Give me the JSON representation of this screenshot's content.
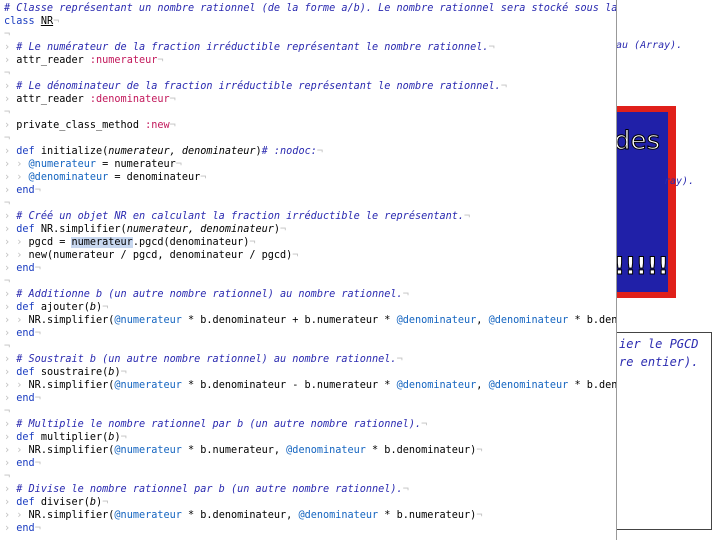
{
  "background": {
    "top_fragments": [
      "au (Array).",
      "ray)."
    ],
    "banner_text": "des",
    "banner_exclaim": "!!!!!",
    "mid_fragments": [
      "ier le PGCD",
      "re entier)."
    ],
    "colors": {
      "red": "#e0201a",
      "blue": "#2020a8"
    }
  },
  "editor": {
    "line_1_comment": "# Classe représentant un nombre rationnel (de la forme a/b). Le nombre rationnel sera stocké sous la forme d'un",
    "line_2_class_kw": "class",
    "line_2_class_name": "NR",
    "comment_num": "# Le numérateur de la fraction irréductible représentant le nombre rationnel.",
    "attr_reader": "attr_reader",
    "sym_num": ":numerateur",
    "comment_den": "# Le dénominateur de la fraction irréductible représentant le nombre rationnel.",
    "sym_den": ":denominateur",
    "private": "private_class_method",
    "sym_new": ":new",
    "def": "def",
    "end": "end",
    "init_name": "initialize(",
    "init_params": "numerateur, denominateur",
    "nodoc": "# :nodoc:",
    "iv_num": "@numerateur",
    "iv_den": "@denominateur",
    "assign_num": " = numerateur",
    "assign_den": " = denominateur",
    "comment_simp": "# Créé un objet NR en calculant la fraction irréductible le représentant.",
    "simp_name": "NR.simplifier(",
    "simp_params": "numerateur, denominateur",
    "pgcd_pre": "pgcd = ",
    "pgcd_hl": "numerateur",
    "pgcd_post": ".pgcd(denominateur)",
    "new_call": "new(numerateur / pgcd, denominateur / pgcd)",
    "comment_add": "# Additionne b (un autre nombre rationnel) au nombre rationnel.",
    "add_name": "ajouter(",
    "b": "b",
    "nr_simp": "NR.simplifier(",
    "add_body_1": " * b.denominateur + b.numerateur * ",
    "add_body_2": ", ",
    "add_body_3": " * b.denominateur)",
    "comment_sub": "# Soustrait b (un autre nombre rationnel) au nombre rationnel.",
    "sub_name": "soustraire(",
    "sub_body_1": " * b.denominateur - b.numerateur * ",
    "comment_mul": "# Multiplie le nombre rationnel par b (un autre nombre rationnel).",
    "mul_name": "multiplier(",
    "mul_body_1": " * b.numerateur, ",
    "mul_body_2": " * b.denominateur)",
    "comment_div": "# Divise le nombre rationnel par b (un autre nombre rationnel).",
    "div_name": "diviser(",
    "div_body_1": " * b.denominateur, ",
    "div_body_2": " * b.numerateur)",
    "pilcrow": "¬",
    "tab": "› ",
    "empty_mark": "¬"
  }
}
